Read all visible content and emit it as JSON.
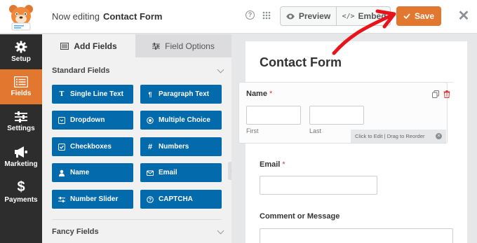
{
  "header": {
    "editing_prefix": "Now editing",
    "form_name": "Contact Form",
    "help_glyph": "?",
    "preview_label": "Preview",
    "embed_label": "Embed",
    "save_label": "Save",
    "close_glyph": "✕"
  },
  "sidebar": {
    "items": [
      {
        "label": "Setup",
        "icon": "gear-icon",
        "active": false
      },
      {
        "label": "Fields",
        "icon": "fields-list-icon",
        "active": true
      },
      {
        "label": "Settings",
        "icon": "sliders-icon",
        "active": false
      },
      {
        "label": "Marketing",
        "icon": "megaphone-icon",
        "active": false
      },
      {
        "label": "Payments",
        "icon": "dollar-icon",
        "active": false
      }
    ]
  },
  "panel": {
    "tabs": [
      {
        "label": "Add Fields",
        "icon": "list-icon",
        "active": true
      },
      {
        "label": "Field Options",
        "icon": "sliders-icon",
        "active": false
      }
    ],
    "standard_title": "Standard Fields",
    "standard_fields": [
      {
        "label": "Single Line Text",
        "icon": "text-icon"
      },
      {
        "label": "Paragraph Text",
        "icon": "paragraph-icon"
      },
      {
        "label": "Dropdown",
        "icon": "dropdown-icon"
      },
      {
        "label": "Multiple Choice",
        "icon": "radio-icon"
      },
      {
        "label": "Checkboxes",
        "icon": "checkbox-icon"
      },
      {
        "label": "Numbers",
        "icon": "hash-icon"
      },
      {
        "label": "Name",
        "icon": "user-icon"
      },
      {
        "label": "Email",
        "icon": "envelope-icon"
      },
      {
        "label": "Number Slider",
        "icon": "slider-icon"
      },
      {
        "label": "CAPTCHA",
        "icon": "question-circle-icon"
      }
    ],
    "fancy_title": "Fancy Fields"
  },
  "preview": {
    "form_title": "Contact Form",
    "name_label": "Name",
    "required_mark": "*",
    "first_label": "First",
    "last_label": "Last",
    "hint_text": "Click to Edit | Drag to Reorder",
    "email_label": "Email",
    "comment_label": "Comment or Message"
  },
  "colors": {
    "accent_orange": "#e27730",
    "field_button_blue": "#036aab",
    "nav_dark": "#2d2d2d",
    "arrow_red": "#e8141b"
  }
}
